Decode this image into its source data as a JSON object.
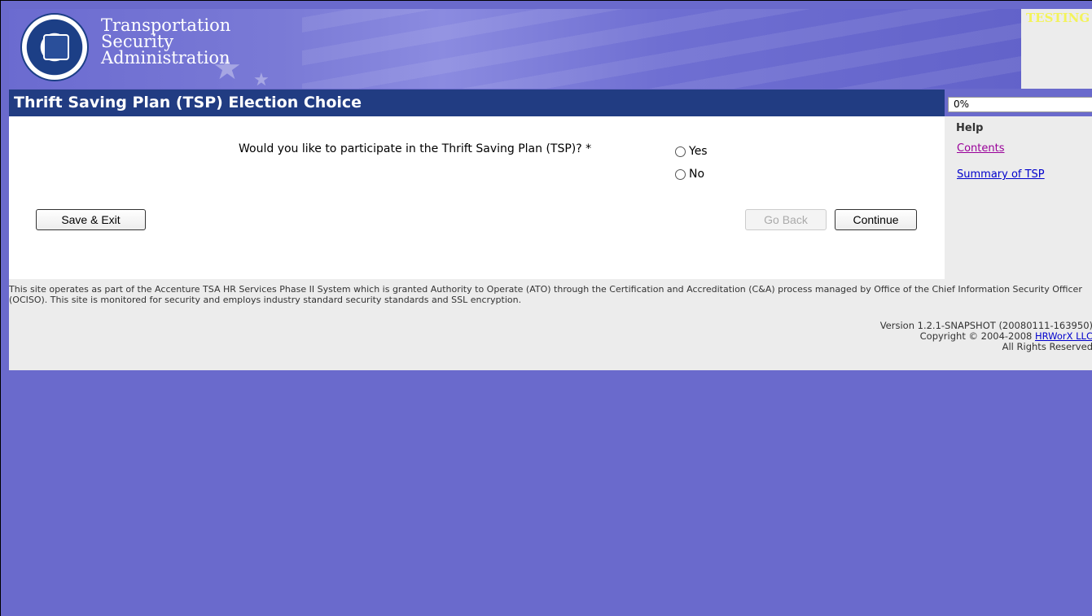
{
  "header": {
    "agency_lines": [
      "Transportation",
      "Security",
      "Administration"
    ],
    "environment_label": "TESTING"
  },
  "page": {
    "title": "Thrift Saving Plan (TSP) Election Choice"
  },
  "progress": {
    "label": "0%",
    "value": 0
  },
  "form": {
    "question": "Would you like to participate in the Thrift Saving Plan (TSP)? *",
    "options": [
      {
        "label": "Yes",
        "selected": false
      },
      {
        "label": "No",
        "selected": false
      }
    ]
  },
  "buttons": {
    "save_exit": "Save & Exit",
    "go_back": "Go Back",
    "continue": "Continue"
  },
  "help": {
    "heading": "Help",
    "links": [
      "Contents",
      "Summary of TSP"
    ]
  },
  "footer": {
    "disclaimer": "This site operates as part of the Accenture TSA HR Services Phase II System which is granted Authority to Operate (ATO) through the Certification and Accreditation (C&A) process managed by Office of the Chief Information Security Officer (OCISO). This site is monitored for security and employs industry standard security standards and SSL encryption.",
    "version": "Version 1.2.1-SNAPSHOT (20080111-163950)",
    "copyright_prefix": "Copyright © 2004-2008 ",
    "company_link": "HRWorX LLC",
    "rights": "All Rights Reserved"
  },
  "colors": {
    "background": "#6a6acc",
    "title_bar": "#213c82",
    "side_panel": "#ececec",
    "testing_label": "#f3f35a",
    "visited_link": "#990099",
    "link": "#0000cc"
  }
}
